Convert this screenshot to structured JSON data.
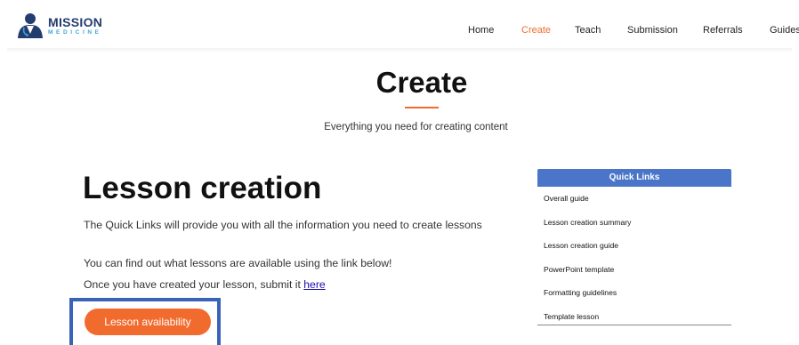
{
  "header": {
    "logo": {
      "title": "MISSION",
      "subtitle": "MEDICINE"
    },
    "nav": [
      {
        "label": "Home",
        "active": false
      },
      {
        "label": "Create",
        "active": true
      },
      {
        "label": "Teach",
        "active": false
      },
      {
        "label": "Submission",
        "active": false
      },
      {
        "label": "Referrals",
        "active": false
      },
      {
        "label": "Guides",
        "active": false
      }
    ]
  },
  "hero": {
    "title": "Create",
    "subtitle": "Everything you need for creating content"
  },
  "lesson": {
    "title": "Lesson creation",
    "para1": "The Quick Links will provide you with all the information you need to create lessons",
    "para2": "You can find out what lessons are available using the link below!",
    "para3_prefix": "Once you have created your lesson, submit it ",
    "para3_link": "here",
    "button_label": "Lesson availability"
  },
  "quick_links": {
    "header": "Quick Links",
    "items": [
      "Overall guide",
      "Lesson creation summary",
      "Lesson creation guide",
      "PowerPoint template",
      "Formatting guidelines",
      "Template lesson"
    ]
  },
  "colors": {
    "accent": "#f26b2e",
    "quick_links_header": "#4a75c8",
    "highlight": "#3a63b8",
    "logo_navy": "#233d6e",
    "logo_blue": "#3aa8d8"
  }
}
